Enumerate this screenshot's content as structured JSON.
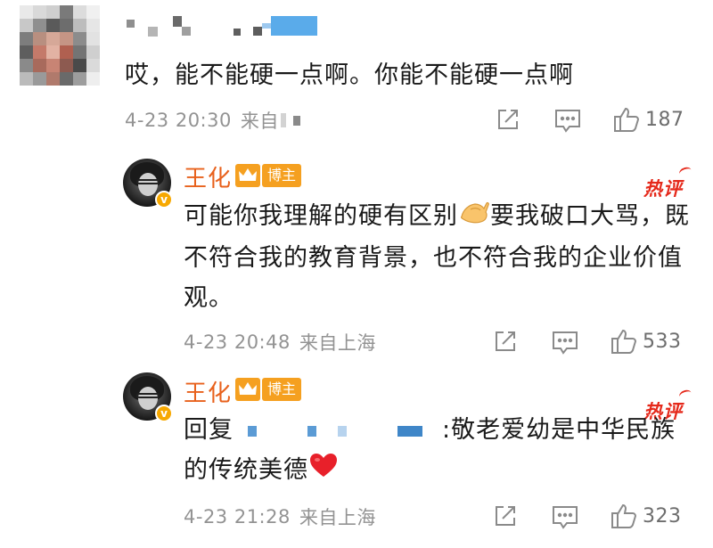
{
  "root_comment": {
    "text": "哎，能不能硬一点啊。你能不能硬一点啊",
    "time": "4-23 20:30",
    "from_prefix": "来自",
    "like_count": "187"
  },
  "replies": [
    {
      "author": "王化",
      "badge": "博主",
      "hot_label": "热评",
      "text_part1": "可能你我理解的硬有区别",
      "text_part2": "要我破口大骂，既不符合我的教育背景，也不符合我的企业价值观。",
      "time": "4-23 20:48",
      "from_label": "来自上海",
      "like_count": "533",
      "emoji": "pinching-hand-emoji"
    },
    {
      "author": "王化",
      "badge": "博主",
      "hot_label": "热评",
      "reply_prefix": "回复",
      "text_part1": ":敬老爱幼是中华民族的传统美德",
      "time": "4-23 21:28",
      "from_label": "来自上海",
      "like_count": "323",
      "emoji": "red-heart-emoji"
    }
  ],
  "colors": {
    "username": "#e8611c",
    "hot_tag": "#e5291b",
    "meta": "#939393",
    "badge": "#f5a020",
    "mask_blue": "#5b9bd5"
  }
}
